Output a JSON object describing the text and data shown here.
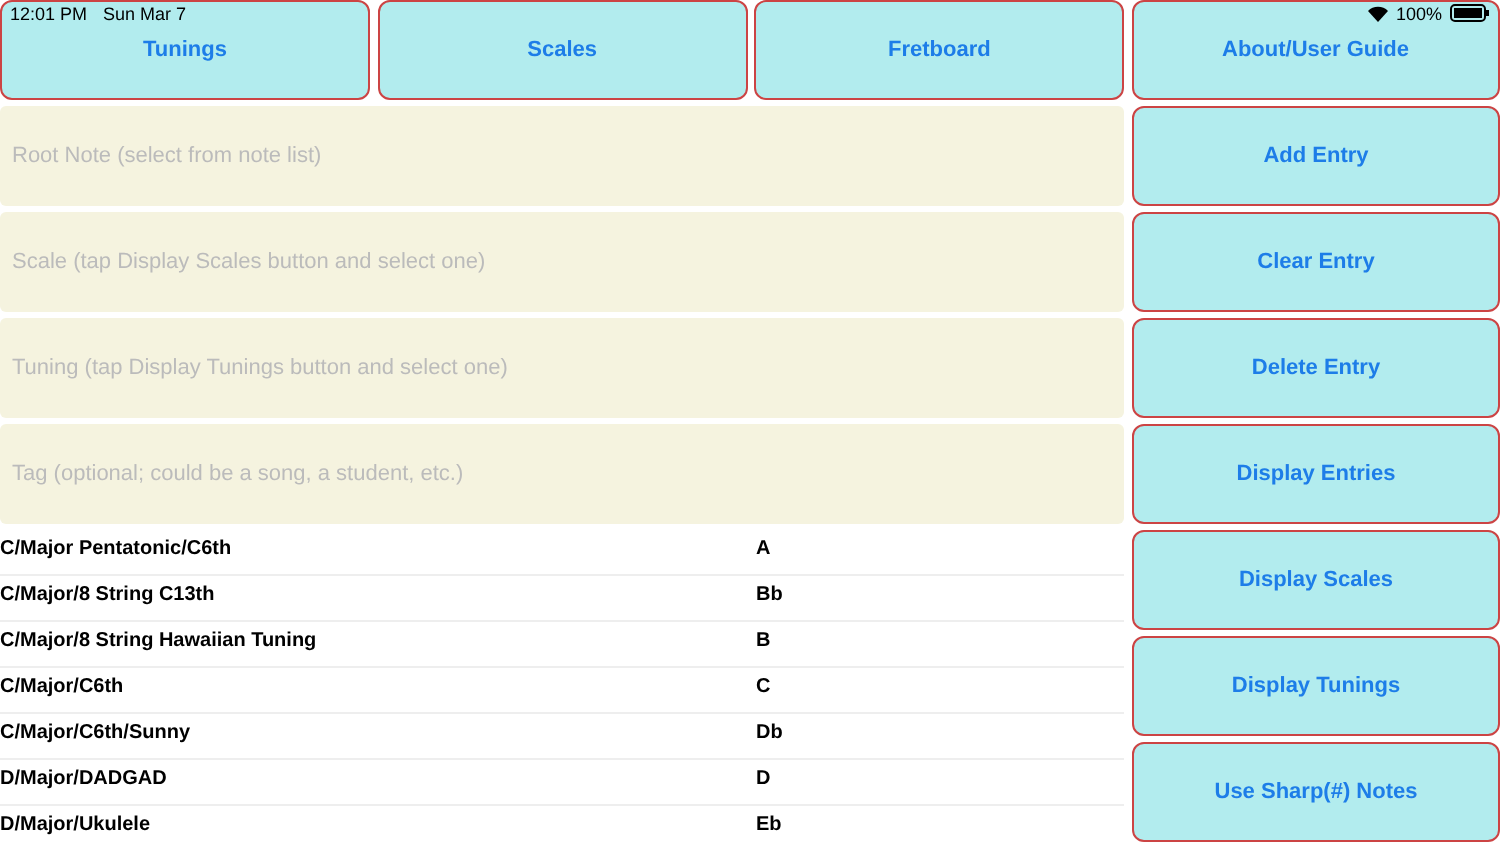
{
  "status_bar": {
    "time": "12:01 PM",
    "date": "Sun Mar 7",
    "battery": "100%"
  },
  "top_buttons": [
    "Tunings",
    "Scales",
    "Fretboard",
    "About/User Guide"
  ],
  "fields": [
    {
      "placeholder": "Root Note (select from note list)"
    },
    {
      "placeholder": "Scale (tap Display Scales button and select one)"
    },
    {
      "placeholder": "Tuning (tap Display Tunings button and select one)"
    },
    {
      "placeholder": "Tag (optional; could be a song, a student, etc.)"
    }
  ],
  "entries": [
    {
      "entry": "C/Major Pentatonic/C6th",
      "note": "A"
    },
    {
      "entry": "C/Major/8 String C13th",
      "note": "Bb"
    },
    {
      "entry": "C/Major/8 String Hawaiian Tuning",
      "note": "B"
    },
    {
      "entry": "C/Major/C6th",
      "note": "C"
    },
    {
      "entry": "C/Major/C6th/Sunny",
      "note": "Db"
    },
    {
      "entry": "D/Major/DADGAD",
      "note": "D"
    },
    {
      "entry": "D/Major/Ukulele",
      "note": "Eb"
    }
  ],
  "side_buttons": [
    "Add Entry",
    "Clear Entry",
    "Delete Entry",
    "Display Entries",
    "Display Scales",
    "Display Tunings",
    "Use Sharp(#) Notes"
  ]
}
